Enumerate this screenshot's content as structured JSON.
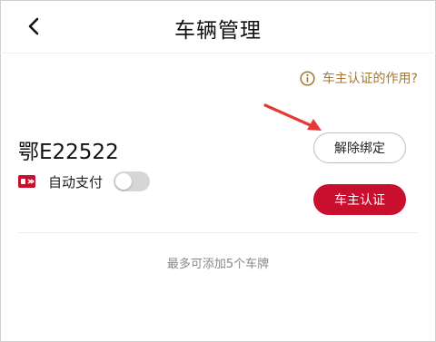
{
  "header": {
    "title": "车辆管理",
    "back_icon": "chevron-left-icon"
  },
  "help": {
    "label": "车主认证的作用?",
    "icon": "info-circle-icon",
    "color": "#a6782a"
  },
  "vehicle": {
    "plate": "鄂E22522",
    "unbind_label": "解除绑定",
    "autopay_label": "自动支付",
    "autopay_enabled": false,
    "autopay_icon": "payment-card-icon",
    "verify_label": "车主认证"
  },
  "footer": {
    "note": "最多可添加5个车牌"
  },
  "colors": {
    "accent": "#c8102e",
    "annotation_arrow": "#e53935",
    "gold": "#a6782a"
  }
}
